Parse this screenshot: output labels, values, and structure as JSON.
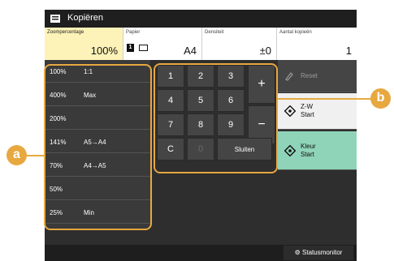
{
  "title": "Kopiëren",
  "fields": {
    "zoom": {
      "label": "Zoompercentage",
      "value": "100%"
    },
    "paper": {
      "label": "Papier",
      "badge": "1",
      "value": "A4"
    },
    "density": {
      "label": "Densiteit",
      "value": "±0"
    },
    "copies": {
      "label": "Aantal kopieën",
      "value": "1"
    }
  },
  "ratios": [
    {
      "pct": "100%",
      "desc": "1:1"
    },
    {
      "pct": "400%",
      "desc": "Max"
    },
    {
      "pct": "200%",
      "desc": ""
    },
    {
      "pct": "141%",
      "desc": "A5→A4"
    },
    {
      "pct": "70%",
      "desc": "A4→A5"
    },
    {
      "pct": "50%",
      "desc": ""
    },
    {
      "pct": "25%",
      "desc": "Min"
    }
  ],
  "keypad": {
    "k1": "1",
    "k2": "2",
    "k3": "3",
    "k4": "4",
    "k5": "5",
    "k6": "6",
    "k7": "7",
    "k8": "8",
    "k9": "9",
    "clear": "C",
    "k0": "0",
    "close": "Sluiten",
    "plus": "+",
    "minus": "−"
  },
  "actions": {
    "reset": "Reset",
    "bw_line1": "Z-W",
    "bw_line2": "Start",
    "color_line1": "Kleur",
    "color_line2": "Start"
  },
  "status_monitor": "Statusmonitor",
  "callouts": {
    "a": "a",
    "b": "b"
  },
  "colors": {
    "highlight": "#e7a840",
    "active_field": "#fdf3b8",
    "color_start": "#8fd4b8"
  },
  "icons": [
    "copy-icon",
    "reset-icon",
    "bw-start-icon",
    "color-start-icon",
    "status-monitor-icon"
  ]
}
